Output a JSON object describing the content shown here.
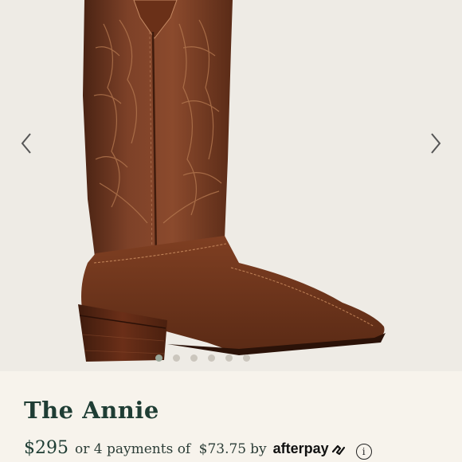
{
  "product": {
    "name": "The Annie",
    "price": "$295",
    "installment_prefix": "or 4 payments of",
    "installment_amount": "$73.75",
    "installment_by": "by",
    "provider": "afterpay",
    "info_symbol": "i"
  },
  "gallery": {
    "image": "boot-photo",
    "slide_count": 6,
    "active_slide": 1
  },
  "colors": {
    "title": "#1f3d34",
    "background": "#f7f3ec",
    "leather": "#7a3d22"
  }
}
